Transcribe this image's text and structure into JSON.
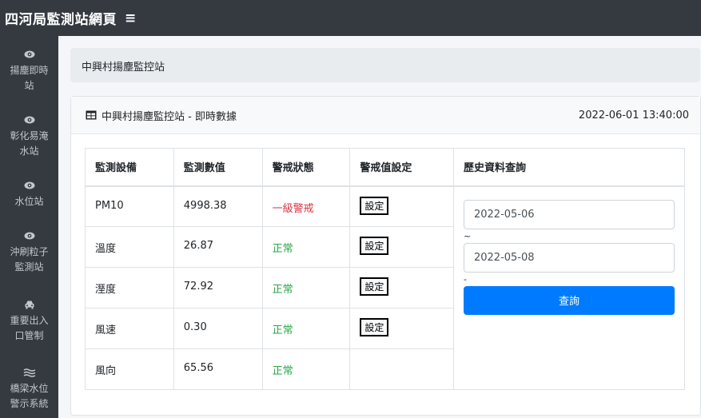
{
  "header": {
    "title": "四河局監測站網頁",
    "menu_icon": "≡"
  },
  "sidebar": {
    "items": [
      {
        "icon": "eye-icon",
        "label": "揚塵即時站"
      },
      {
        "icon": "eye-icon",
        "label": "彰化易淹水站"
      },
      {
        "icon": "eye-icon",
        "label": "水位站"
      },
      {
        "icon": "eye-icon",
        "label": "沖刷粒子監測站"
      },
      {
        "icon": "car-icon",
        "label": "重要出入口管制"
      },
      {
        "icon": "water-icon",
        "label": "橋梁水位警示系統"
      }
    ]
  },
  "breadcrumb": {
    "text": "中興村揚塵監控站"
  },
  "card": {
    "title": "中興村揚塵監控站 - 即時數據",
    "timestamp": "2022-06-01 13:40:00"
  },
  "table": {
    "headers": [
      "監測設備",
      "監測數值",
      "警戒狀態",
      "警戒值設定",
      "歷史資料查詢"
    ],
    "rows": [
      {
        "device": "PM10",
        "value": "4998.38",
        "status": "一級警戒",
        "status_level": "alert",
        "button": "設定"
      },
      {
        "device": "溫度",
        "value": "26.87",
        "status": "正常",
        "status_level": "normal",
        "button": "設定"
      },
      {
        "device": "溼度",
        "value": "72.92",
        "status": "正常",
        "status_level": "normal",
        "button": "設定"
      },
      {
        "device": "風速",
        "value": "0.30",
        "status": "正常",
        "status_level": "normal",
        "button": "設定"
      },
      {
        "device": "風向",
        "value": "65.56",
        "status": "正常",
        "status_level": "normal",
        "button": ""
      }
    ]
  },
  "history": {
    "start_date": "2022-05-06",
    "range_separator": "~",
    "end_date": "2022-05-08",
    "after_separator": "-",
    "query_label": "查詢"
  },
  "colors": {
    "alert": "#dc3545",
    "normal": "#28a745",
    "primary": "#007bff",
    "dark": "#343a40"
  }
}
